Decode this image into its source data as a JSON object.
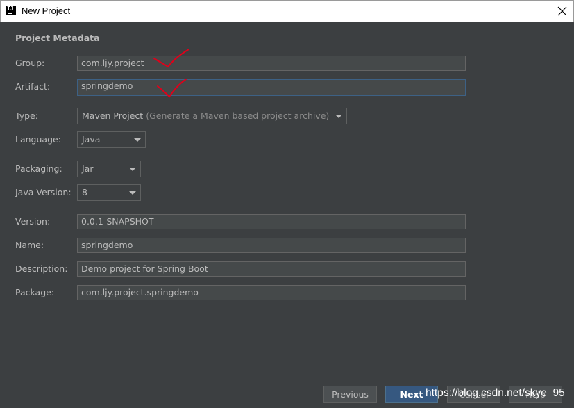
{
  "window": {
    "title": "New Project",
    "icon": "intellij-icon",
    "icon_text": "IJ"
  },
  "section": {
    "title": "Project Metadata"
  },
  "fields": {
    "group": {
      "label": "Group:",
      "value": "com.ljy.project"
    },
    "artifact": {
      "label": "Artifact:",
      "value": "springdemo"
    },
    "type": {
      "label": "Type:",
      "value": "Maven Project",
      "hint": "(Generate a Maven based project archive)"
    },
    "language": {
      "label": "Language:",
      "value": "Java"
    },
    "packaging": {
      "label": "Packaging:",
      "value": "Jar"
    },
    "java_version": {
      "label": "Java Version:",
      "value": "8"
    },
    "version": {
      "label": "Version:",
      "value": "0.0.1-SNAPSHOT"
    },
    "name": {
      "label": "Name:",
      "value": "springdemo"
    },
    "description": {
      "label": "Description:",
      "value": "Demo project for Spring Boot"
    },
    "package": {
      "label": "Package:",
      "value": "com.ljy.project.springdemo"
    }
  },
  "buttons": {
    "previous": "Previous",
    "next": "Next",
    "cancel": "Cancel",
    "help": "Help"
  },
  "watermark": "https://blog.csdn.net/skye_95",
  "colors": {
    "background": "#3c3f41",
    "field_bg": "#45494a",
    "focus_border": "#3d6185",
    "primary_button": "#365880",
    "annotation": "#e0001a"
  }
}
